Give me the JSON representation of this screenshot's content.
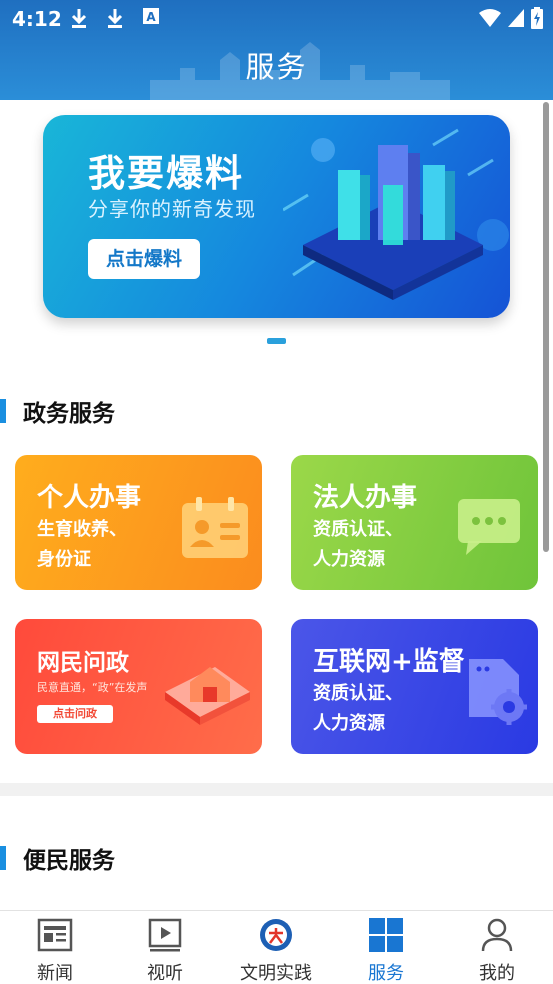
{
  "status_bar": {
    "time": "4:12"
  },
  "header": {
    "title": "服务"
  },
  "banner": {
    "title": "我要爆料",
    "subtitle": "分享你的新奇发现",
    "button_label": "点击爆料"
  },
  "sections": {
    "gov": {
      "title": "政务服务"
    },
    "convenience": {
      "title": "便民服务"
    }
  },
  "cards": {
    "personal": {
      "title": "个人办事",
      "line1": "生育收养、",
      "line2": "身份证"
    },
    "legal": {
      "title": "法人办事",
      "line1": "资质认证、",
      "line2": "人力资源"
    },
    "netizen": {
      "title": "网民问政",
      "subtitle": "民意直通，“政”在发声",
      "button_label": "点击问政"
    },
    "internet": {
      "title": "互联网+监督",
      "line1": "资质认证、",
      "line2": "人力资源"
    }
  },
  "bottom_nav": {
    "items": [
      {
        "label": "新闻",
        "icon": "news-icon"
      },
      {
        "label": "视听",
        "icon": "video-icon"
      },
      {
        "label": "文明实践",
        "icon": "civilization-logo-icon"
      },
      {
        "label": "服务",
        "icon": "service-grid-icon"
      },
      {
        "label": "我的",
        "icon": "profile-icon"
      }
    ],
    "active_index": 3
  },
  "colors": {
    "header": "#1f6fc0",
    "accent": "#1976d2",
    "card_personal": "#fb8c1e",
    "card_legal": "#6fc43a",
    "card_netizen": "#ff4a3b",
    "card_internet": "#2a3ae3"
  }
}
